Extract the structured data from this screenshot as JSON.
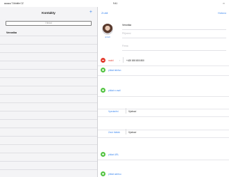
{
  "status_bar": {
    "carrier": "●●●●● T-Mobile CZ",
    "time": "9:41",
    "battery": ""
  },
  "contacts_pane": {
    "title": "Kontakty",
    "add_label": "+",
    "search_placeholder": "Hledat",
    "contacts": [
      "Veronika"
    ]
  },
  "edit_pane": {
    "cancel_label": "Zrušit",
    "done_label": "Hotovo",
    "avatar_edit_label": "upravit",
    "first_name": "Veronika",
    "last_name_placeholder": "Příjmení",
    "company_placeholder": "Firma",
    "phone": {
      "label": "mobil",
      "value": "+420 800 800 800"
    },
    "add_phone_label": "přidat telefon",
    "add_email_label": "přidat e-mail",
    "ringtone": {
      "label": "Vyzvánění",
      "value": "Výchozí"
    },
    "text_tone": {
      "label": "Zvuk hlášek",
      "value": "Výchozí"
    },
    "add_url_label": "přidat URL",
    "add_address_label": "přidat adresu"
  },
  "colors": {
    "accent": "#3d87ef",
    "delete": "#e33b2e",
    "add": "#56c545"
  },
  "icons": [
    "minus-circle-icon",
    "plus-circle-icon",
    "chevron-right-icon",
    "avatar-photo"
  ]
}
